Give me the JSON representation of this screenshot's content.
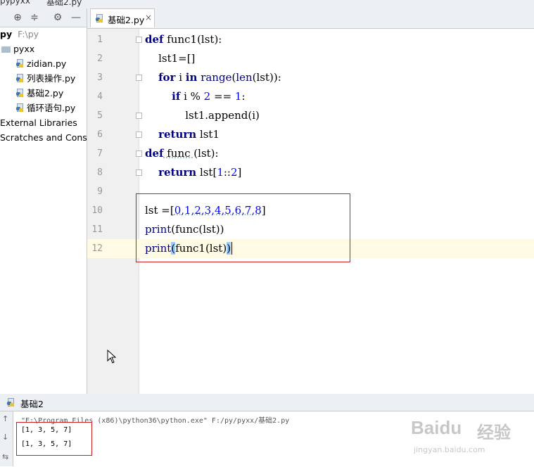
{
  "breadcrumb": {
    "items": [
      "py",
      "pyxx",
      "基础2.py"
    ]
  },
  "project_panel": {
    "root_label": "py",
    "root_path": "F:\\py",
    "folder": "pyxx",
    "files": [
      "zidian.py",
      "列表操作.py",
      "基础2.py",
      "循环语句.py"
    ],
    "external_libraries": "External Libraries",
    "scratches": "Scratches and Consoles"
  },
  "editor": {
    "tab_label": "基础2.py",
    "tab_close": "×",
    "line_numbers": [
      "1",
      "2",
      "3",
      "4",
      "5",
      "6",
      "7",
      "8",
      "9",
      "10",
      "11",
      "12"
    ],
    "lines": {
      "l1": {
        "kw": "def",
        "rest": " func1(lst):"
      },
      "l2": {
        "text": "    lst1=[]"
      },
      "l3": {
        "kw": "for",
        "a": " i ",
        "kw2": "in",
        "bi": "range",
        "b": "(",
        "bi2": "len",
        "c": "(lst)):"
      },
      "l4": {
        "kw": "if",
        "a": " i % ",
        "n1": "2",
        "b": " == ",
        "n2": "1",
        "c": ":"
      },
      "l5": {
        "text": "            lst1.append(i)"
      },
      "l6": {
        "kw": "return",
        "rest": " lst1"
      },
      "l7": {
        "kw": "def",
        "fn": " func ",
        "rest": "(lst):"
      },
      "l8": {
        "kw": "return",
        "a": " lst[",
        "n1": "1",
        "b": "::",
        "n2": "2",
        "c": "]"
      },
      "l10": {
        "a": "lst =[",
        "nums": "0,1,2,3,4,5,6,7,8",
        "c": "]"
      },
      "l11": {
        "bi": "print",
        "rest": "(func(lst))"
      },
      "l12": {
        "bi": "print",
        "p1": "(",
        "mid": "func1(lst)",
        "p2": ")"
      }
    }
  },
  "run_panel": {
    "tab_label": "基础2",
    "command": "\"E:\\Program Files (x86)\\python36\\python.exe\" F:/py/pyxx/基础2.py",
    "output": [
      "[1, 3, 5, 7]",
      "[1, 3, 5, 7]"
    ]
  },
  "watermark": {
    "brand": "Baidu",
    "cn": "经验",
    "url": "jingyan.baidu.com"
  },
  "colors": {
    "keyword": "#000080",
    "number": "#0000ff",
    "highlight_box": "#d11a1a",
    "current_line": "#fffae3"
  }
}
